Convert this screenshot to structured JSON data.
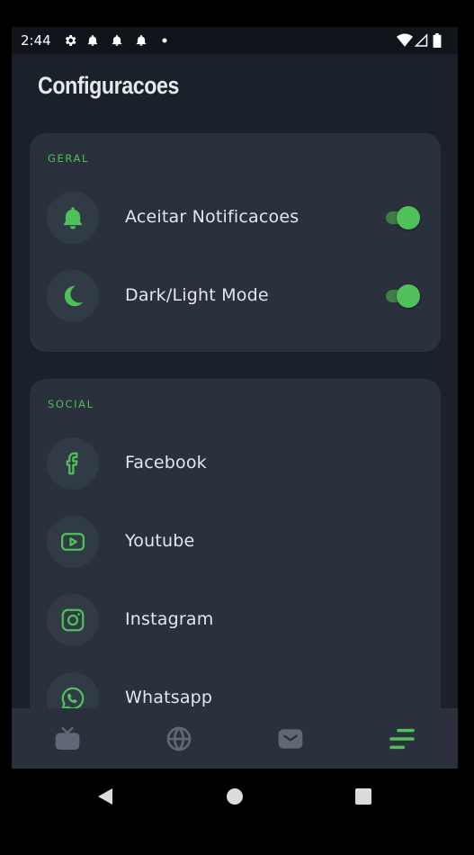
{
  "status_bar": {
    "time": "2:44"
  },
  "page": {
    "title": "Configuracoes"
  },
  "sections": {
    "general": {
      "header": "GERAL",
      "items": [
        {
          "label": "Aceitar Notificacoes",
          "icon": "bell-icon",
          "toggle": true
        },
        {
          "label": "Dark/Light Mode",
          "icon": "moon-icon",
          "toggle": true
        }
      ]
    },
    "social": {
      "header": "SOCIAL",
      "items": [
        {
          "label": "Facebook",
          "icon": "facebook-icon"
        },
        {
          "label": "Youtube",
          "icon": "youtube-icon"
        },
        {
          "label": "Instagram",
          "icon": "instagram-icon"
        },
        {
          "label": "Whatsapp",
          "icon": "whatsapp-icon"
        }
      ]
    }
  },
  "bottom_nav": {
    "items": [
      {
        "icon": "tv-icon",
        "active": false
      },
      {
        "icon": "globe-icon",
        "active": false
      },
      {
        "icon": "mail-icon",
        "active": false
      },
      {
        "icon": "menu-icon",
        "active": true
      }
    ]
  },
  "colors": {
    "accent": "#4fc05a",
    "background": "#1b212b",
    "card": "#2a313d",
    "icon_circle": "#313b45",
    "text": "#e3e6ea",
    "inactive_icon": "#5f6874"
  }
}
